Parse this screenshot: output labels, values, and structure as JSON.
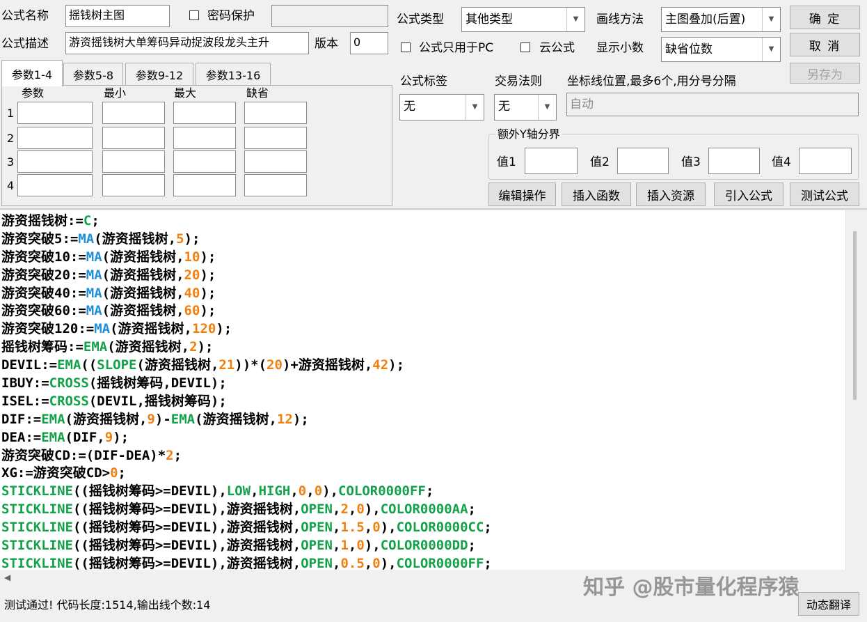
{
  "header": {
    "name_label": "公式名称",
    "name_value": "摇钱树主图",
    "password_label": "密码保护",
    "desc_label": "公式描述",
    "desc_value": "游资摇钱树大单筹码异动捉波段龙头主升",
    "version_label": "版本",
    "version_value": "0",
    "type_label": "公式类型",
    "type_value": "其他类型",
    "draw_label": "画线方法",
    "draw_value": "主图叠加(后置)",
    "pc_only_label": "公式只用于PC",
    "cloud_label": "云公式",
    "decimals_label": "显示小数",
    "decimals_value": "缺省位数",
    "ok_label": "确 定",
    "cancel_label": "取 消",
    "saveas_label": "另存为"
  },
  "params": {
    "tabs": [
      "参数1-4",
      "参数5-8",
      "参数9-12",
      "参数13-16"
    ],
    "columns": [
      "参数",
      "最小",
      "最大",
      "缺省"
    ],
    "rows": [
      "1",
      "2",
      "3",
      "4"
    ]
  },
  "tags": {
    "tag_label": "公式标签",
    "tag_value": "无",
    "trade_label": "交易法则",
    "trade_value": "无",
    "axis_label": "坐标线位置,最多6个,用分号分隔",
    "axis_value": "自动",
    "extra_y_label": "额外Y轴分界",
    "values": [
      "值1",
      "值2",
      "值3",
      "值4"
    ]
  },
  "actions": [
    "编辑操作",
    "插入函数",
    "插入资源",
    "引入公式",
    "测试公式"
  ],
  "code_lines": [
    [
      [
        "游资摇钱树:=",
        "id"
      ],
      [
        "C",
        "fg"
      ],
      [
        ";",
        "id"
      ]
    ],
    [
      [
        "游资突破5:=",
        "id"
      ],
      [
        "MA",
        "fn"
      ],
      [
        "(游资摇钱树,",
        "id"
      ],
      [
        "5",
        "num"
      ],
      [
        ");",
        "id"
      ]
    ],
    [
      [
        "游资突破10:=",
        "id"
      ],
      [
        "MA",
        "fn"
      ],
      [
        "(游资摇钱树,",
        "id"
      ],
      [
        "10",
        "num"
      ],
      [
        ");",
        "id"
      ]
    ],
    [
      [
        "游资突破20:=",
        "id"
      ],
      [
        "MA",
        "fn"
      ],
      [
        "(游资摇钱树,",
        "id"
      ],
      [
        "20",
        "num"
      ],
      [
        ");",
        "id"
      ]
    ],
    [
      [
        "游资突破40:=",
        "id"
      ],
      [
        "MA",
        "fn"
      ],
      [
        "(游资摇钱树,",
        "id"
      ],
      [
        "40",
        "num"
      ],
      [
        ");",
        "id"
      ]
    ],
    [
      [
        "游资突破60:=",
        "id"
      ],
      [
        "MA",
        "fn"
      ],
      [
        "(游资摇钱树,",
        "id"
      ],
      [
        "60",
        "num"
      ],
      [
        ");",
        "id"
      ]
    ],
    [
      [
        "游资突破120:=",
        "id"
      ],
      [
        "MA",
        "fn"
      ],
      [
        "(游资摇钱树,",
        "id"
      ],
      [
        "120",
        "num"
      ],
      [
        ");",
        "id"
      ]
    ],
    [
      [
        "摇钱树筹码:=",
        "id"
      ],
      [
        "EMA",
        "fg"
      ],
      [
        "(游资摇钱树,",
        "id"
      ],
      [
        "2",
        "num"
      ],
      [
        ");",
        "id"
      ]
    ],
    [
      [
        "DEVIL:=",
        "id"
      ],
      [
        "EMA",
        "fg"
      ],
      [
        "((",
        "id"
      ],
      [
        "SLOPE",
        "fg"
      ],
      [
        "(游资摇钱树,",
        "id"
      ],
      [
        "21",
        "num"
      ],
      [
        "))*(",
        "id"
      ],
      [
        "20",
        "num"
      ],
      [
        ")+游资摇钱树,",
        "id"
      ],
      [
        "42",
        "num"
      ],
      [
        ");",
        "id"
      ]
    ],
    [
      [
        "IBUY:=",
        "id"
      ],
      [
        "CROSS",
        "fg"
      ],
      [
        "(摇钱树筹码,DEVIL);",
        "id"
      ]
    ],
    [
      [
        "ISEL:=",
        "id"
      ],
      [
        "CROSS",
        "fg"
      ],
      [
        "(DEVIL,摇钱树筹码);",
        "id"
      ]
    ],
    [
      [
        "DIF:=",
        "id"
      ],
      [
        "EMA",
        "fg"
      ],
      [
        "(游资摇钱树,",
        "id"
      ],
      [
        "9",
        "num"
      ],
      [
        ")-",
        "id"
      ],
      [
        "EMA",
        "fg"
      ],
      [
        "(游资摇钱树,",
        "id"
      ],
      [
        "12",
        "num"
      ],
      [
        ");",
        "id"
      ]
    ],
    [
      [
        "DEA:=",
        "id"
      ],
      [
        "EMA",
        "fg"
      ],
      [
        "(DIF,",
        "id"
      ],
      [
        "9",
        "num"
      ],
      [
        ");",
        "id"
      ]
    ],
    [
      [
        "游资突破CD:=(DIF-DEA)*",
        "id"
      ],
      [
        "2",
        "num"
      ],
      [
        ";",
        "id"
      ]
    ],
    [
      [
        "XG:=游资突破CD>",
        "id"
      ],
      [
        "0",
        "num"
      ],
      [
        ";",
        "id"
      ]
    ],
    [
      [
        "STICKLINE",
        "fg"
      ],
      [
        "((摇钱树筹码>=DEVIL),",
        "id"
      ],
      [
        "LOW",
        "fg"
      ],
      [
        ",",
        "id"
      ],
      [
        "HIGH",
        "fg"
      ],
      [
        ",",
        "id"
      ],
      [
        "0",
        "num"
      ],
      [
        ",",
        "id"
      ],
      [
        "0",
        "num"
      ],
      [
        "),",
        "id"
      ],
      [
        "COLOR0000FF",
        "fg"
      ],
      [
        ";",
        "id"
      ]
    ],
    [
      [
        "STICKLINE",
        "fg"
      ],
      [
        "((摇钱树筹码>=DEVIL),游资摇钱树,",
        "id"
      ],
      [
        "OPEN",
        "fg"
      ],
      [
        ",",
        "id"
      ],
      [
        "2",
        "num"
      ],
      [
        ",",
        "id"
      ],
      [
        "0",
        "num"
      ],
      [
        "),",
        "id"
      ],
      [
        "COLOR0000AA",
        "fg"
      ],
      [
        ";",
        "id"
      ]
    ],
    [
      [
        "STICKLINE",
        "fg"
      ],
      [
        "((摇钱树筹码>=DEVIL),游资摇钱树,",
        "id"
      ],
      [
        "OPEN",
        "fg"
      ],
      [
        ",",
        "id"
      ],
      [
        "1.5",
        "num"
      ],
      [
        ",",
        "id"
      ],
      [
        "0",
        "num"
      ],
      [
        "),",
        "id"
      ],
      [
        "COLOR0000CC",
        "fg"
      ],
      [
        ";",
        "id"
      ]
    ],
    [
      [
        "STICKLINE",
        "fg"
      ],
      [
        "((摇钱树筹码>=DEVIL),游资摇钱树,",
        "id"
      ],
      [
        "OPEN",
        "fg"
      ],
      [
        ",",
        "id"
      ],
      [
        "1",
        "num"
      ],
      [
        ",",
        "id"
      ],
      [
        "0",
        "num"
      ],
      [
        "),",
        "id"
      ],
      [
        "COLOR0000DD",
        "fg"
      ],
      [
        ";",
        "id"
      ]
    ],
    [
      [
        "STICKLINE",
        "fg"
      ],
      [
        "((摇钱树筹码>=DEVIL),游资摇钱树,",
        "id"
      ],
      [
        "OPEN",
        "fg"
      ],
      [
        ",",
        "id"
      ],
      [
        "0.5",
        "num"
      ],
      [
        ",",
        "id"
      ],
      [
        "0",
        "num"
      ],
      [
        "),",
        "id"
      ],
      [
        "COLOR0000FF",
        "fg"
      ],
      [
        ";",
        "id"
      ]
    ]
  ],
  "status": {
    "message": "测试通过! 代码长度:1514,输出线个数:14",
    "translate_label": "动态翻译",
    "watermark": "知乎 @股市量化程序猿"
  },
  "colors": {
    "function_blue": "#1e8fd8",
    "keyword_green": "#13a24a",
    "number_orange": "#f08010"
  }
}
